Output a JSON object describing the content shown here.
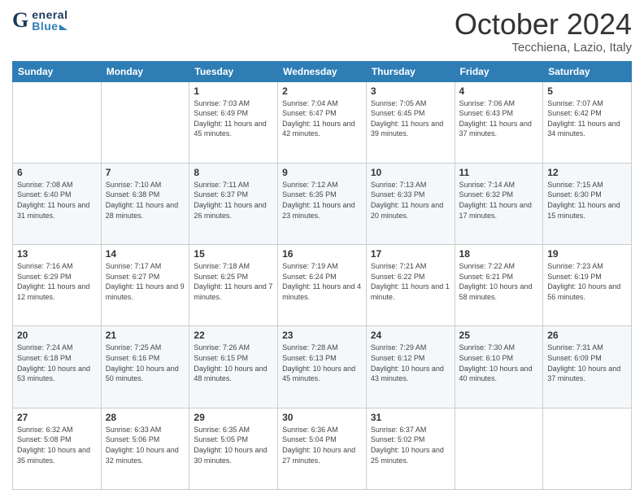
{
  "header": {
    "logo_g": "G",
    "logo_eneral": "eneral",
    "logo_blue": "Blue",
    "month_title": "October 2024",
    "location": "Tecchiena, Lazio, Italy"
  },
  "days_of_week": [
    "Sunday",
    "Monday",
    "Tuesday",
    "Wednesday",
    "Thursday",
    "Friday",
    "Saturday"
  ],
  "weeks": [
    [
      {
        "day": "",
        "sunrise": "",
        "sunset": "",
        "daylight": ""
      },
      {
        "day": "",
        "sunrise": "",
        "sunset": "",
        "daylight": ""
      },
      {
        "day": "1",
        "sunrise": "Sunrise: 7:03 AM",
        "sunset": "Sunset: 6:49 PM",
        "daylight": "Daylight: 11 hours and 45 minutes."
      },
      {
        "day": "2",
        "sunrise": "Sunrise: 7:04 AM",
        "sunset": "Sunset: 6:47 PM",
        "daylight": "Daylight: 11 hours and 42 minutes."
      },
      {
        "day": "3",
        "sunrise": "Sunrise: 7:05 AM",
        "sunset": "Sunset: 6:45 PM",
        "daylight": "Daylight: 11 hours and 39 minutes."
      },
      {
        "day": "4",
        "sunrise": "Sunrise: 7:06 AM",
        "sunset": "Sunset: 6:43 PM",
        "daylight": "Daylight: 11 hours and 37 minutes."
      },
      {
        "day": "5",
        "sunrise": "Sunrise: 7:07 AM",
        "sunset": "Sunset: 6:42 PM",
        "daylight": "Daylight: 11 hours and 34 minutes."
      }
    ],
    [
      {
        "day": "6",
        "sunrise": "Sunrise: 7:08 AM",
        "sunset": "Sunset: 6:40 PM",
        "daylight": "Daylight: 11 hours and 31 minutes."
      },
      {
        "day": "7",
        "sunrise": "Sunrise: 7:10 AM",
        "sunset": "Sunset: 6:38 PM",
        "daylight": "Daylight: 11 hours and 28 minutes."
      },
      {
        "day": "8",
        "sunrise": "Sunrise: 7:11 AM",
        "sunset": "Sunset: 6:37 PM",
        "daylight": "Daylight: 11 hours and 26 minutes."
      },
      {
        "day": "9",
        "sunrise": "Sunrise: 7:12 AM",
        "sunset": "Sunset: 6:35 PM",
        "daylight": "Daylight: 11 hours and 23 minutes."
      },
      {
        "day": "10",
        "sunrise": "Sunrise: 7:13 AM",
        "sunset": "Sunset: 6:33 PM",
        "daylight": "Daylight: 11 hours and 20 minutes."
      },
      {
        "day": "11",
        "sunrise": "Sunrise: 7:14 AM",
        "sunset": "Sunset: 6:32 PM",
        "daylight": "Daylight: 11 hours and 17 minutes."
      },
      {
        "day": "12",
        "sunrise": "Sunrise: 7:15 AM",
        "sunset": "Sunset: 6:30 PM",
        "daylight": "Daylight: 11 hours and 15 minutes."
      }
    ],
    [
      {
        "day": "13",
        "sunrise": "Sunrise: 7:16 AM",
        "sunset": "Sunset: 6:29 PM",
        "daylight": "Daylight: 11 hours and 12 minutes."
      },
      {
        "day": "14",
        "sunrise": "Sunrise: 7:17 AM",
        "sunset": "Sunset: 6:27 PM",
        "daylight": "Daylight: 11 hours and 9 minutes."
      },
      {
        "day": "15",
        "sunrise": "Sunrise: 7:18 AM",
        "sunset": "Sunset: 6:25 PM",
        "daylight": "Daylight: 11 hours and 7 minutes."
      },
      {
        "day": "16",
        "sunrise": "Sunrise: 7:19 AM",
        "sunset": "Sunset: 6:24 PM",
        "daylight": "Daylight: 11 hours and 4 minutes."
      },
      {
        "day": "17",
        "sunrise": "Sunrise: 7:21 AM",
        "sunset": "Sunset: 6:22 PM",
        "daylight": "Daylight: 11 hours and 1 minute."
      },
      {
        "day": "18",
        "sunrise": "Sunrise: 7:22 AM",
        "sunset": "Sunset: 6:21 PM",
        "daylight": "Daylight: 10 hours and 58 minutes."
      },
      {
        "day": "19",
        "sunrise": "Sunrise: 7:23 AM",
        "sunset": "Sunset: 6:19 PM",
        "daylight": "Daylight: 10 hours and 56 minutes."
      }
    ],
    [
      {
        "day": "20",
        "sunrise": "Sunrise: 7:24 AM",
        "sunset": "Sunset: 6:18 PM",
        "daylight": "Daylight: 10 hours and 53 minutes."
      },
      {
        "day": "21",
        "sunrise": "Sunrise: 7:25 AM",
        "sunset": "Sunset: 6:16 PM",
        "daylight": "Daylight: 10 hours and 50 minutes."
      },
      {
        "day": "22",
        "sunrise": "Sunrise: 7:26 AM",
        "sunset": "Sunset: 6:15 PM",
        "daylight": "Daylight: 10 hours and 48 minutes."
      },
      {
        "day": "23",
        "sunrise": "Sunrise: 7:28 AM",
        "sunset": "Sunset: 6:13 PM",
        "daylight": "Daylight: 10 hours and 45 minutes."
      },
      {
        "day": "24",
        "sunrise": "Sunrise: 7:29 AM",
        "sunset": "Sunset: 6:12 PM",
        "daylight": "Daylight: 10 hours and 43 minutes."
      },
      {
        "day": "25",
        "sunrise": "Sunrise: 7:30 AM",
        "sunset": "Sunset: 6:10 PM",
        "daylight": "Daylight: 10 hours and 40 minutes."
      },
      {
        "day": "26",
        "sunrise": "Sunrise: 7:31 AM",
        "sunset": "Sunset: 6:09 PM",
        "daylight": "Daylight: 10 hours and 37 minutes."
      }
    ],
    [
      {
        "day": "27",
        "sunrise": "Sunrise: 6:32 AM",
        "sunset": "Sunset: 5:08 PM",
        "daylight": "Daylight: 10 hours and 35 minutes."
      },
      {
        "day": "28",
        "sunrise": "Sunrise: 6:33 AM",
        "sunset": "Sunset: 5:06 PM",
        "daylight": "Daylight: 10 hours and 32 minutes."
      },
      {
        "day": "29",
        "sunrise": "Sunrise: 6:35 AM",
        "sunset": "Sunset: 5:05 PM",
        "daylight": "Daylight: 10 hours and 30 minutes."
      },
      {
        "day": "30",
        "sunrise": "Sunrise: 6:36 AM",
        "sunset": "Sunset: 5:04 PM",
        "daylight": "Daylight: 10 hours and 27 minutes."
      },
      {
        "day": "31",
        "sunrise": "Sunrise: 6:37 AM",
        "sunset": "Sunset: 5:02 PM",
        "daylight": "Daylight: 10 hours and 25 minutes."
      },
      {
        "day": "",
        "sunrise": "",
        "sunset": "",
        "daylight": ""
      },
      {
        "day": "",
        "sunrise": "",
        "sunset": "",
        "daylight": ""
      }
    ]
  ]
}
